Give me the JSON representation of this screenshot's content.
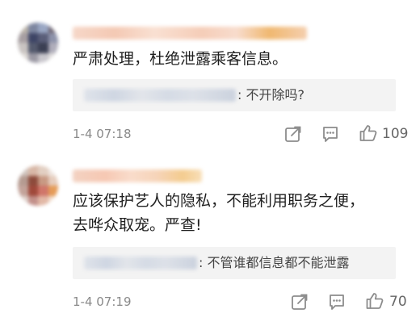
{
  "comments": [
    {
      "text_lines": [
        "严肃处理，杜绝泄露乘客信息。"
      ],
      "reply": {
        "text": ": 不开除吗?"
      },
      "time": "1-4 07:18",
      "likes": "109",
      "icons": [
        "share-icon",
        "comment-icon",
        "like-icon"
      ]
    },
    {
      "text_lines": [
        "应该保护艺人的隐私，不能利用职务之便，",
        "去哗众取宠。严查!"
      ],
      "reply": {
        "text": ": 不管谁都信息都不能泄露"
      },
      "time": "1-4 07:19",
      "likes": "70",
      "icons": [
        "share-icon",
        "comment-icon",
        "like-icon"
      ]
    }
  ],
  "colors": {
    "background": "#ffffff",
    "reply_background": "#f3f3f3",
    "meta_text": "#8a8a8a",
    "icon": "#8c8c8c"
  }
}
